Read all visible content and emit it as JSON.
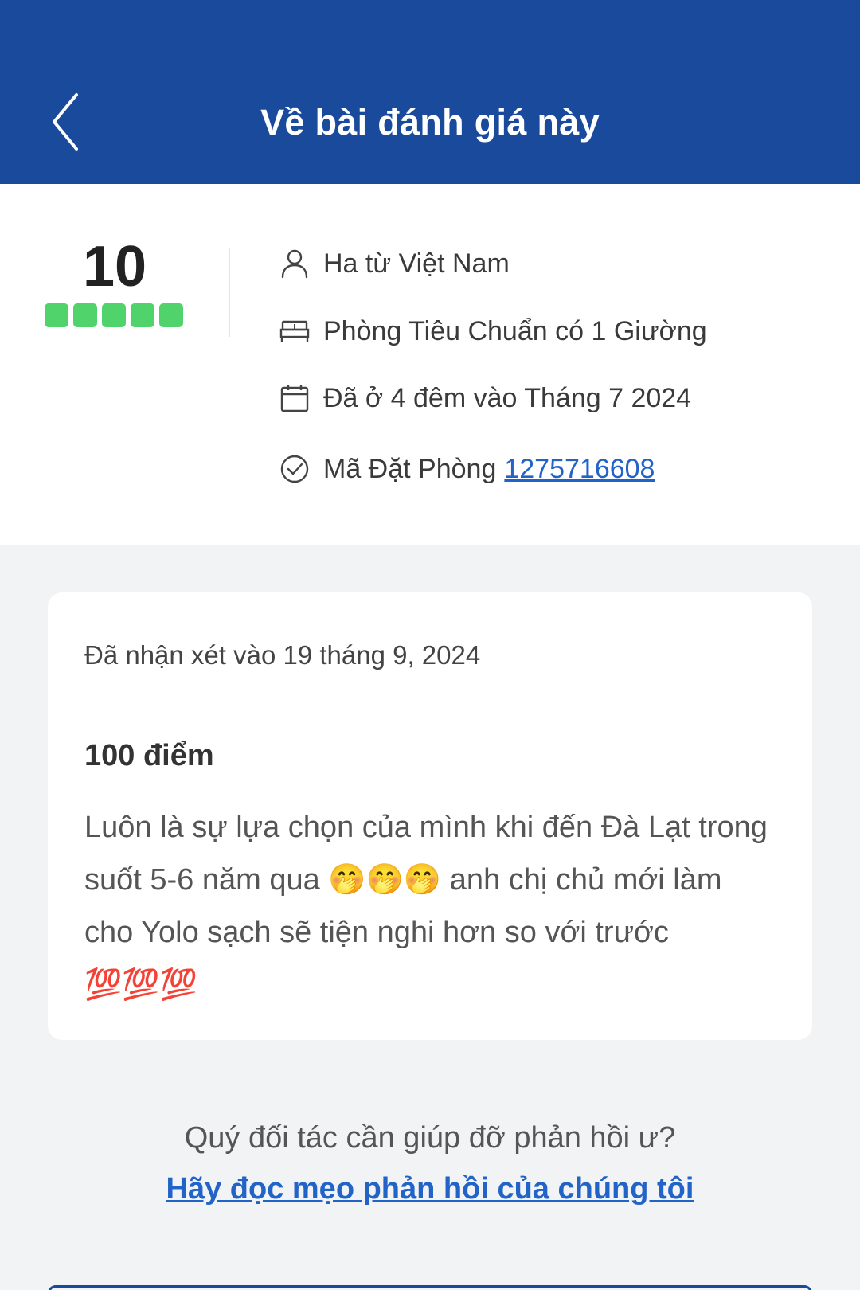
{
  "header": {
    "title": "Về bài đánh giá này",
    "back_icon": "chevron-left-icon",
    "background_color": "#1a4a9c"
  },
  "rating": {
    "score": "10",
    "bars_filled": 5,
    "bars_total": 5,
    "bar_color": "#4fd36a"
  },
  "details": {
    "guest": "Ha từ Việt Nam",
    "room": "Phòng Tiêu Chuẩn có 1 Giường",
    "stay": "Đã ở 4 đêm vào Tháng 7 2024",
    "booking_label": "Mã Đặt Phòng",
    "booking_number": "1275716608"
  },
  "review": {
    "date": "Đã nhận xét vào 19 tháng 9, 2024",
    "title": "100 điểm",
    "body": "Luôn là sự lựa chọn của mình khi đến Đà Lạt trong suốt 5-6 năm qua 🤭🤭🤭 anh chị chủ mới làm cho Yolo sạch sẽ tiện nghi hơn so với trước 💯💯💯"
  },
  "footer": {
    "help_text": "Quý đối tác cần giúp đỡ phản hồi ư?",
    "help_link": "Hãy đọc mẹo phản hồi của chúng tôi"
  }
}
